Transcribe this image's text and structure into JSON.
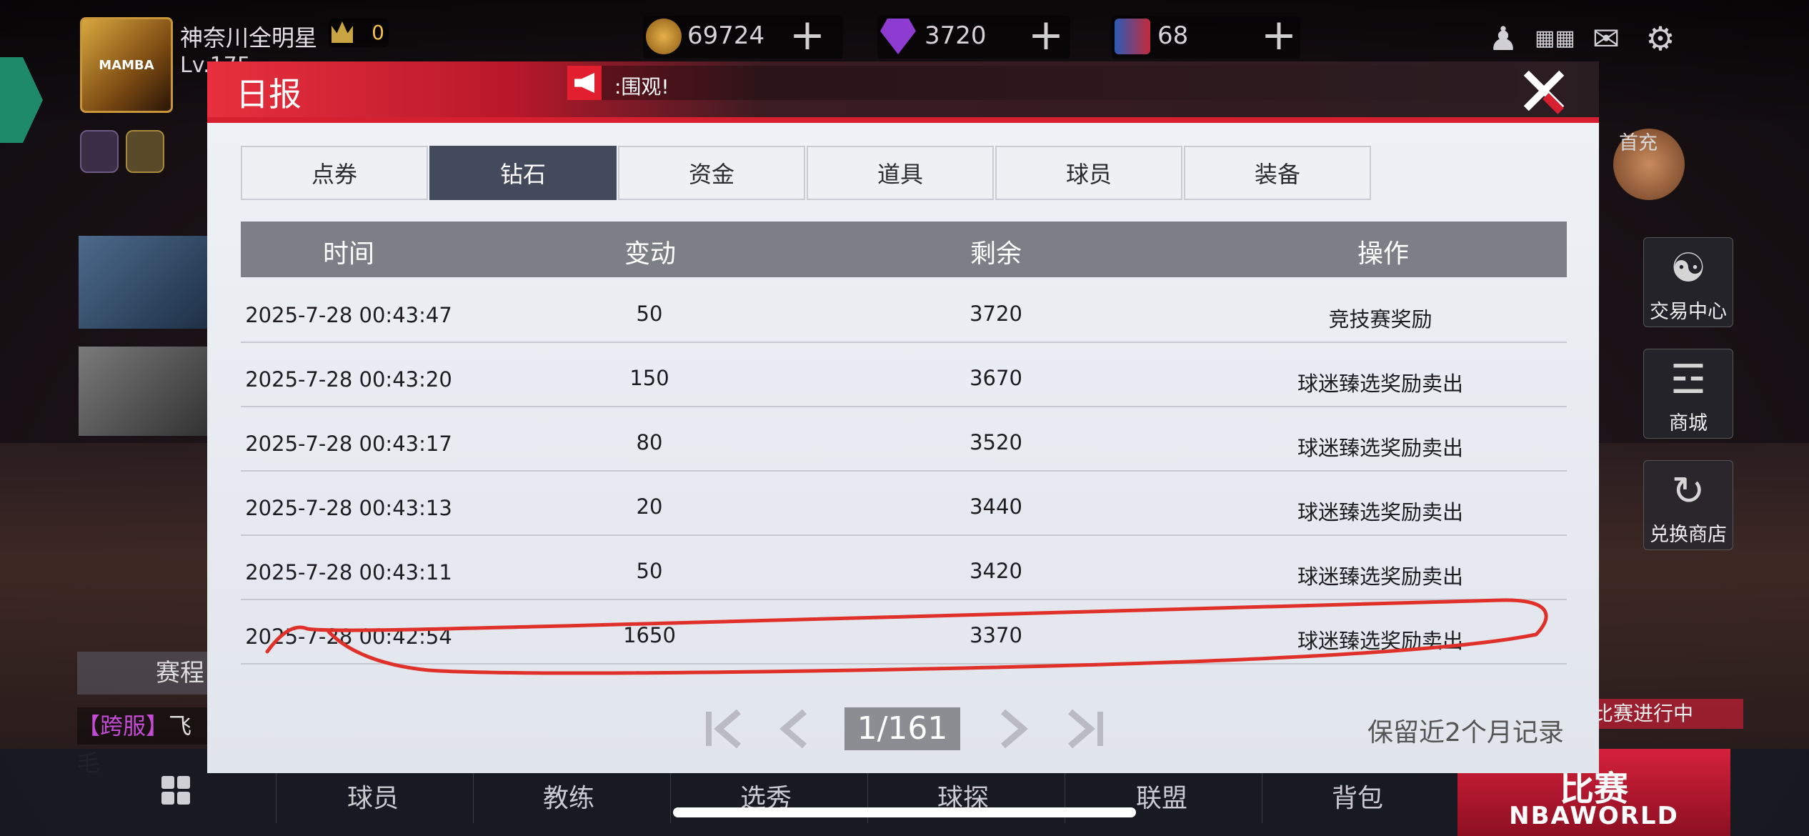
{
  "hud": {
    "player_name": "神奈川全明星",
    "level": "Lv.175",
    "crown_count": "0",
    "avatar_text": "MAMBA",
    "points": "69724",
    "diamonds": "3720",
    "tickets": "68"
  },
  "side_buttons": {
    "first_charge": "首充",
    "trade_center": "交易中心",
    "shop": "商城",
    "exchange_shop": "兑换商店"
  },
  "left_panel": {
    "schedule": "赛程",
    "cross_server_tag": "【跨服】",
    "cross_server_text": "飞毛"
  },
  "match_status": "比赛进行中",
  "bottom_nav": {
    "items": [
      "球员",
      "教练",
      "选秀",
      "球探",
      "联盟",
      "背包"
    ],
    "match_button": "比赛",
    "match_button_sub": "NBAWORLD"
  },
  "dialog": {
    "title": "日报",
    "announcement": ":围观!",
    "tabs": [
      "点券",
      "钻石",
      "资金",
      "道具",
      "球员",
      "装备"
    ],
    "active_tab": "钻石",
    "columns": [
      "时间",
      "变动",
      "剩余",
      "操作"
    ],
    "rows": [
      {
        "time": "2025-7-28 00:43:47",
        "change": "50",
        "remaining": "3720",
        "action": "竞技赛奖励"
      },
      {
        "time": "2025-7-28 00:43:20",
        "change": "150",
        "remaining": "3670",
        "action": "球迷臻选奖励卖出"
      },
      {
        "time": "2025-7-28 00:43:17",
        "change": "80",
        "remaining": "3520",
        "action": "球迷臻选奖励卖出"
      },
      {
        "time": "2025-7-28 00:43:13",
        "change": "20",
        "remaining": "3440",
        "action": "球迷臻选奖励卖出"
      },
      {
        "time": "2025-7-28 00:43:11",
        "change": "50",
        "remaining": "3420",
        "action": "球迷臻选奖励卖出"
      },
      {
        "time": "2025-7-28 00:42:54",
        "change": "1650",
        "remaining": "3370",
        "action": "球迷臻选奖励卖出"
      }
    ],
    "pagination": {
      "page": "1/161"
    },
    "retention_note": "保留近2个月记录"
  },
  "colors": {
    "accent_red": "#d61f2f",
    "active_tab": "#424a5c",
    "annotation": "#e0302a"
  }
}
